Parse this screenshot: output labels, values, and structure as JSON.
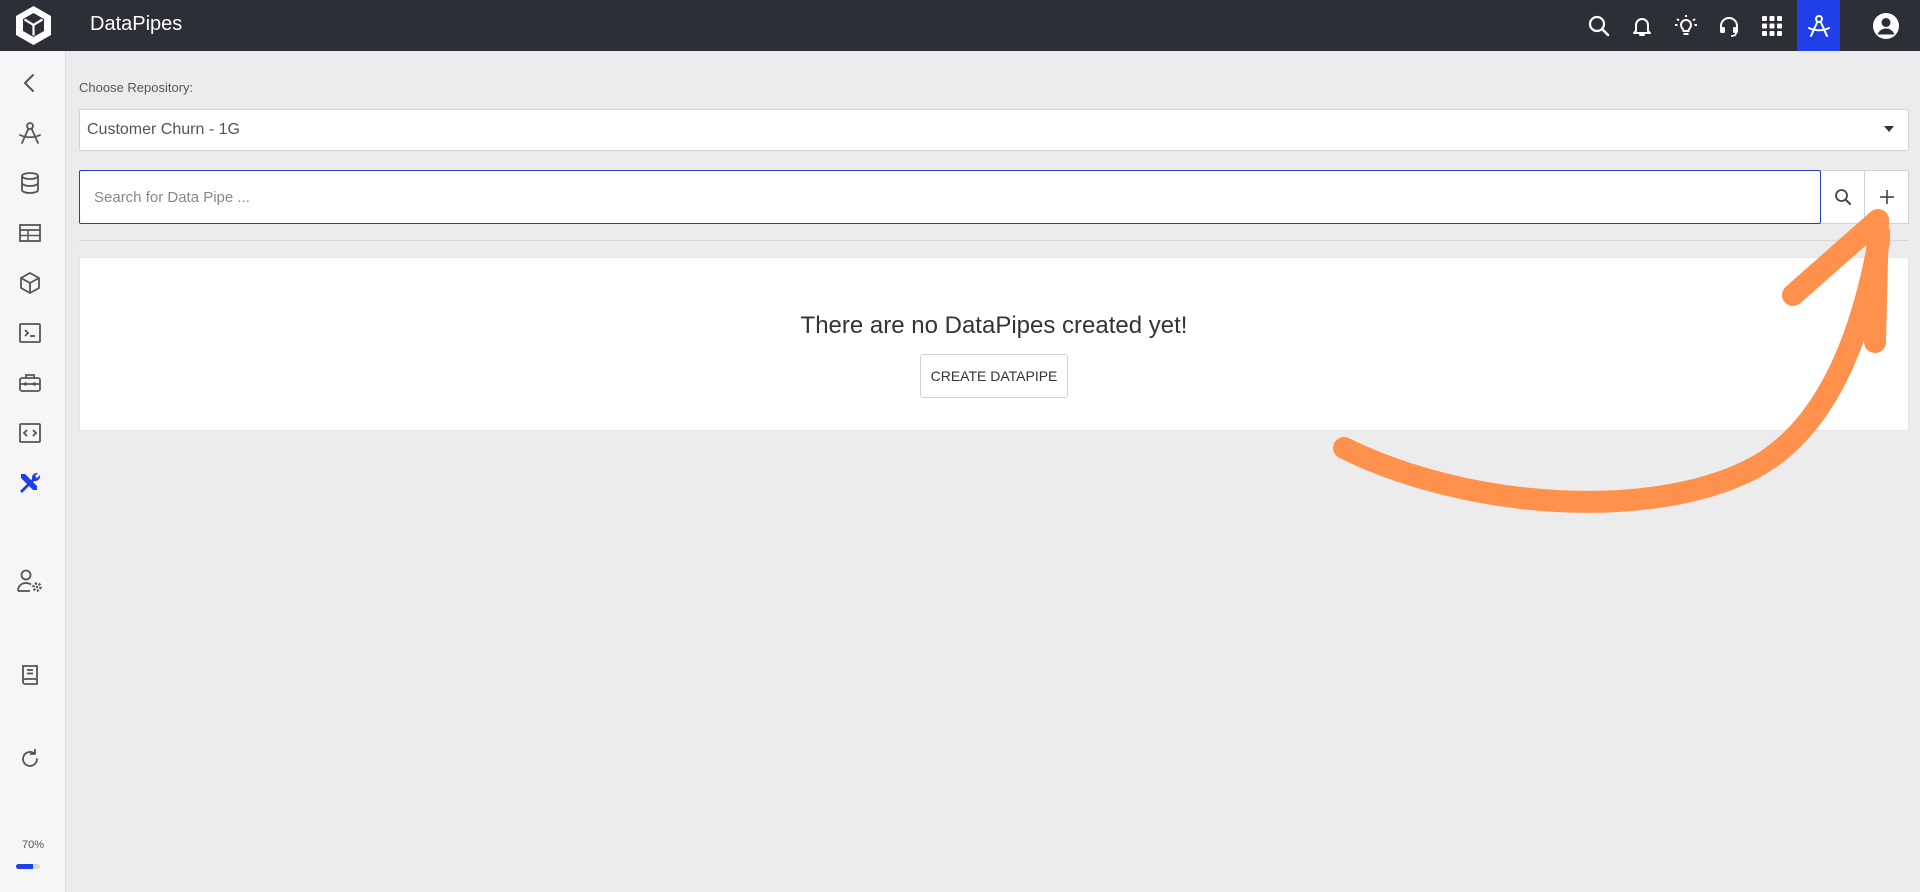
{
  "header": {
    "app_title": "DataPipes",
    "icons": [
      "search-icon",
      "bell-icon",
      "lightbulb-icon",
      "headset-icon",
      "apps-grid-icon",
      "compass-icon",
      "account-icon"
    ]
  },
  "sidebar": {
    "items": [
      "back-icon",
      "compass-icon",
      "database-icon",
      "table-icon",
      "cube-icon",
      "terminal-icon",
      "toolbox-icon",
      "code-icon",
      "tools-icon",
      "user-settings-icon",
      "book-icon",
      "refresh-icon"
    ],
    "active_item": "tools-icon",
    "zoom": {
      "label": "70%",
      "value": 0.7
    }
  },
  "main": {
    "repo_label": "Choose Repository:",
    "repo_selected": "Customer Churn - 1G",
    "search_placeholder": "Search for Data Pipe ...",
    "search_value": "",
    "empty_message": "There are no DataPipes created yet!",
    "create_button_label": "CREATE DATAPIPE"
  },
  "colors": {
    "topbar": "#2c3036",
    "accent": "#1f3fe8",
    "arrow": "#ff914d",
    "background": "#ececec"
  }
}
